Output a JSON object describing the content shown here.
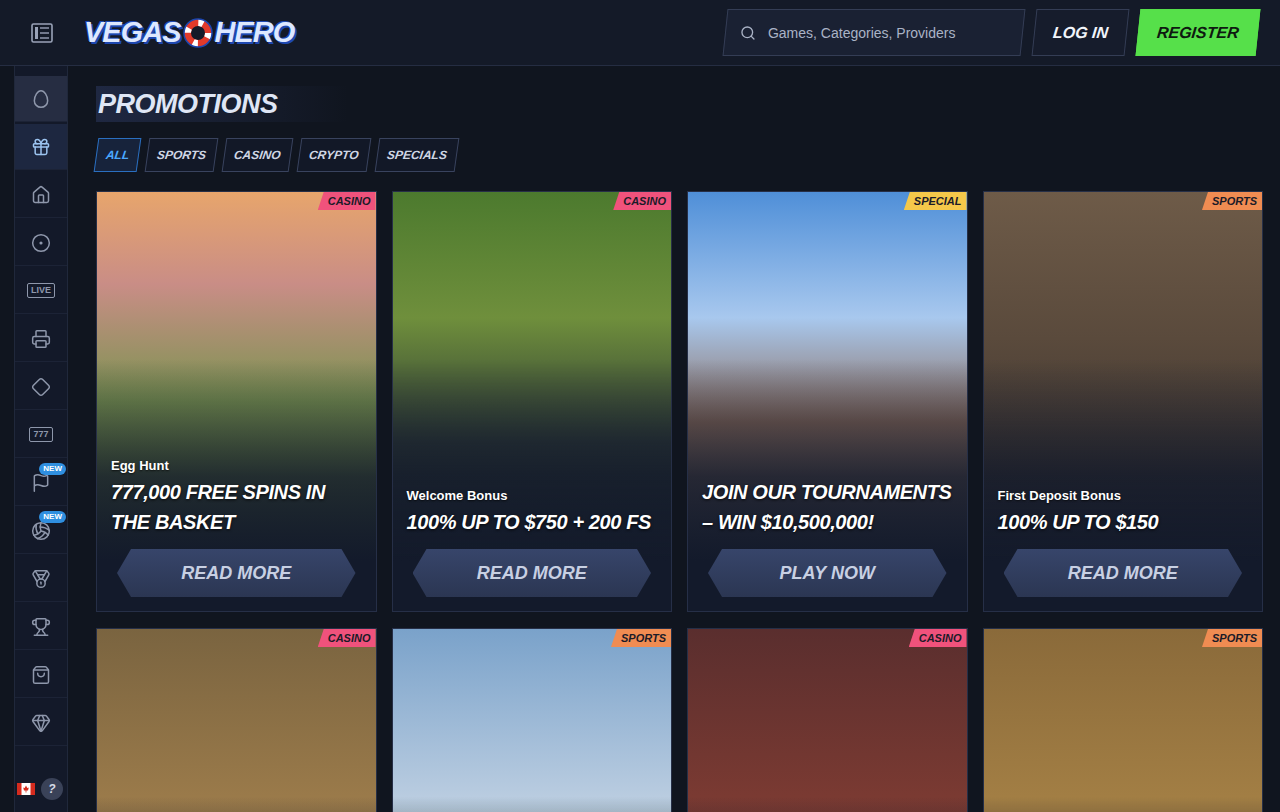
{
  "header": {
    "logo": {
      "left": "VEGAS",
      "right": "HERO"
    },
    "search": {
      "placeholder": "Games, Categories, Providers"
    },
    "login": "LOG IN",
    "register": "REGISTER"
  },
  "sidebar": {
    "items": [
      {
        "kind": "icon",
        "selected": false,
        "highlighted": true
      },
      {
        "kind": "icon",
        "selected": true,
        "highlighted": false
      },
      {
        "kind": "icon",
        "selected": false,
        "highlighted": false
      },
      {
        "kind": "icon",
        "selected": false,
        "highlighted": false
      },
      {
        "kind": "text",
        "label": "LIVE",
        "selected": false,
        "highlighted": false
      },
      {
        "kind": "icon",
        "selected": false,
        "highlighted": false
      },
      {
        "kind": "icon",
        "selected": false,
        "highlighted": false
      },
      {
        "kind": "text",
        "label": "777",
        "selected": false,
        "highlighted": false
      },
      {
        "kind": "icon",
        "selected": false,
        "highlighted": false,
        "badge": "NEW"
      },
      {
        "kind": "icon",
        "selected": false,
        "highlighted": false,
        "badge": "NEW"
      },
      {
        "kind": "icon",
        "selected": false,
        "highlighted": false
      },
      {
        "kind": "icon",
        "selected": false,
        "highlighted": false
      },
      {
        "kind": "icon",
        "selected": false,
        "highlighted": false
      },
      {
        "kind": "icon",
        "selected": false,
        "highlighted": false
      }
    ],
    "footer": {
      "help": "?"
    }
  },
  "page": {
    "title": "PROMOTIONS"
  },
  "filters": [
    {
      "label": "ALL",
      "selected": true
    },
    {
      "label": "SPORTS",
      "selected": false
    },
    {
      "label": "CASINO",
      "selected": false
    },
    {
      "label": "CRYPTO",
      "selected": false
    },
    {
      "label": "SPECIALS",
      "selected": false
    }
  ],
  "promotions": [
    {
      "category": "CASINO",
      "color": "#f0527c",
      "subtitle": "Egg Hunt",
      "title": "777,000 FREE SPINS IN THE BASKET",
      "button": "READ MORE"
    },
    {
      "category": "CASINO",
      "color": "#f0527c",
      "subtitle": "Welcome Bonus",
      "title": "100% UP TO $750 + 200 FS",
      "button": "READ MORE"
    },
    {
      "category": "SPECIAL",
      "color": "#f5c84a",
      "title": "JOIN OUR TOURNAMENTS – WIN $10,500,000!",
      "button": "PLAY NOW"
    },
    {
      "category": "SPORTS",
      "color": "#f08c52",
      "subtitle": "First Deposit Bonus",
      "title": "100% UP TO $150",
      "button": "READ MORE"
    },
    {
      "category": "CASINO",
      "color": "#f0527c"
    },
    {
      "category": "SPORTS",
      "color": "#f08c52"
    },
    {
      "category": "CASINO",
      "color": "#f0527c"
    },
    {
      "category": "SPORTS",
      "color": "#f08c52"
    }
  ]
}
